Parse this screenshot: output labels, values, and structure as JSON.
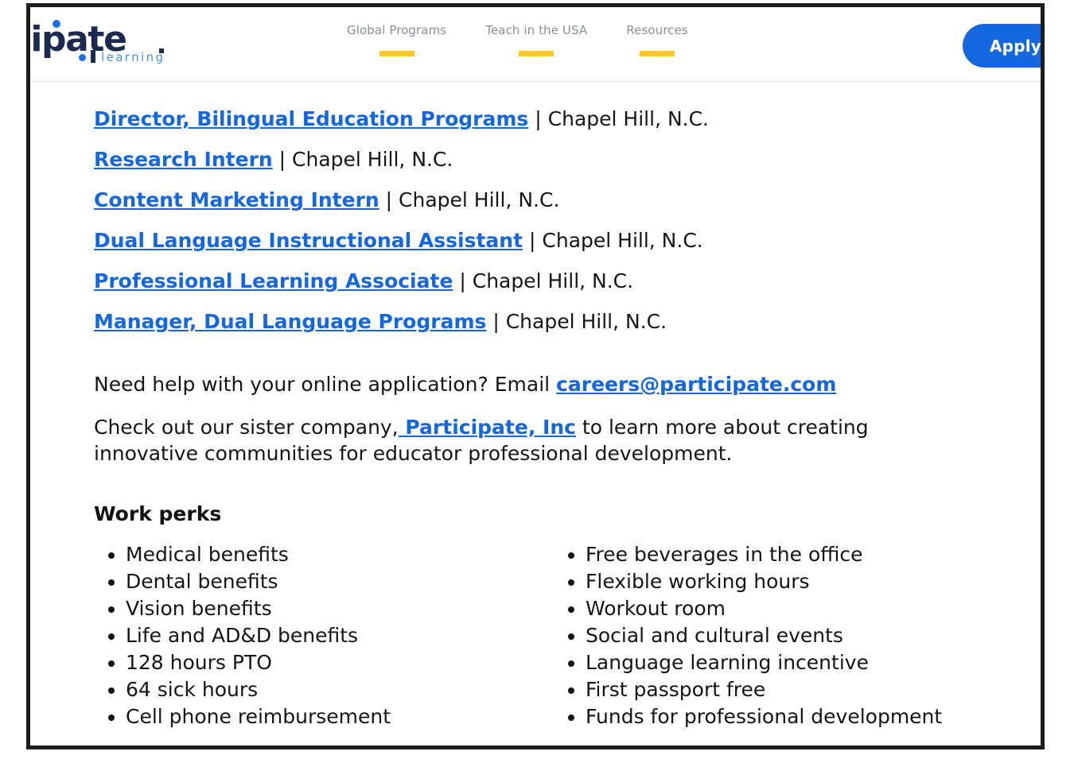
{
  "header": {
    "logo": {
      "wordmark": "icipate",
      "tagline": "learning",
      "brand_navy": "#1b2a4e",
      "brand_blue": "#1a73e8"
    },
    "nav": [
      {
        "label": "Global Programs"
      },
      {
        "label": "Teach in the USA"
      },
      {
        "label": "Resources"
      }
    ],
    "nav_underline_color": "#ffc629",
    "apply_button": {
      "label": "Apply to",
      "background": "#1567e0"
    }
  },
  "main": {
    "jobs": [
      {
        "title": "Director, Bilingual Education Programs",
        "separator": " | ",
        "location": "Chapel Hill, N.C."
      },
      {
        "title": "Research Intern",
        "separator": " | ",
        "location": "Chapel Hill, N.C."
      },
      {
        "title": "Content Marketing Intern",
        "separator": " | ",
        "location": "Chapel Hill, N.C."
      },
      {
        "title": "Dual Language Instructional Assistant",
        "separator": " | ",
        "location": "Chapel Hill, N.C."
      },
      {
        "title": "Professional Learning Associate",
        "separator": " | ",
        "location": "Chapel Hill, N.C."
      },
      {
        "title": "Manager, Dual Language Programs",
        "separator": " | ",
        "location": "Chapel Hill, N.C."
      }
    ],
    "help_paragraph": {
      "lead": "Need help with your online application? Email ",
      "email_link": "careers@participate.com"
    },
    "sister_paragraph": {
      "lead": "Check out our sister company,",
      "company_link": " Participate, Inc",
      "tail": " to learn more about creating innovative communities for educator professional development."
    },
    "perks": {
      "heading": "Work perks",
      "left_column": [
        "Medical benefits",
        "Dental benefits",
        "Vision benefits",
        "Life and AD&D benefits",
        "128 hours PTO",
        "64 sick hours",
        "Cell phone reimbursement"
      ],
      "right_column": [
        "Free beverages in the office",
        "Flexible working hours",
        "Workout room",
        "Social and cultural events",
        "Language learning incentive",
        "First passport free",
        "Funds for professional development"
      ]
    }
  },
  "colors": {
    "link_blue": "#1567e0",
    "accent_yellow": "#ffc629",
    "text_black": "#151515",
    "nav_gray": "#8a8f99"
  }
}
